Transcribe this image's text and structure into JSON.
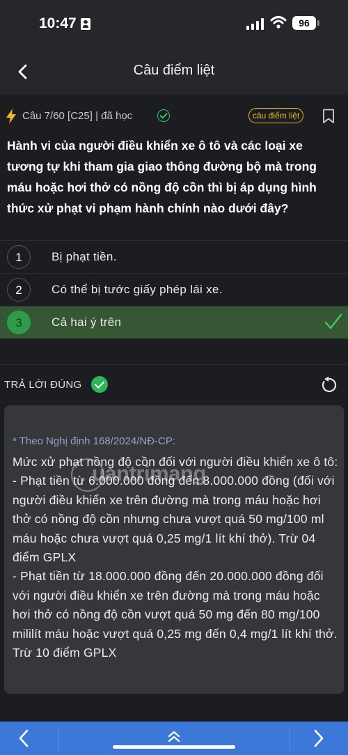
{
  "status_bar": {
    "time": "10:47",
    "battery": "96"
  },
  "header": {
    "title": "Câu điểm liệt"
  },
  "question_meta": {
    "text": "Câu 7/60 [C25] | đã học",
    "tag": "câu điểm liệt"
  },
  "question": {
    "text": "Hành vi của người điều khiển xe ô tô và các loại xe tương tự khi tham gia giao thông đường bộ mà trong máu hoặc hơi thở có nồng độ cồn thì bị áp dụng hình thức xử phạt vi phạm hành chính nào dưới đây?"
  },
  "answers": [
    {
      "number": "1",
      "text": "Bị phạt tiền."
    },
    {
      "number": "2",
      "text": "Có thể bị tước giấy phép lái xe."
    },
    {
      "number": "3",
      "text": "Cả hai ý trên"
    }
  ],
  "result": {
    "label": "TRẢ LỜI ĐÚNG"
  },
  "explanation": {
    "source": "* Theo Nghị định 168/2024/NĐ-CP:",
    "body": "Mức xử phạt nồng độ cồn đối với người điều khiển xe ô tô:\n- Phạt tiền từ 6.000.000 đồng đến 8.000.000 đồng (đối với người điều khiển xe trên đường mà trong máu hoặc hơi thở có nồng độ cồn nhưng chưa vượt quá 50 mg/100 ml máu hoặc chưa vượt quá 0,25 mg/1 lít khí thở). Trừ 04 điểm GPLX\n- Phạt tiền từ 18.000.000 đồng đến 20.000.000 đồng đối với người điều khiển xe trên đường mà trong máu hoặc hơi thở có nồng độ cồn vượt quá 50 mg đến 80 mg/100 mililít máu hoặc vượt quá 0,25 mg đến 0,4 mg/1 lít khí thở. Trừ 10 điểm GPLX"
  },
  "watermark": {
    "text": "uantrimang"
  },
  "colors": {
    "accent": "#3c78d8",
    "correct_bg": "#355733",
    "correct_green": "#2fb457",
    "tag": "#f0b624"
  }
}
